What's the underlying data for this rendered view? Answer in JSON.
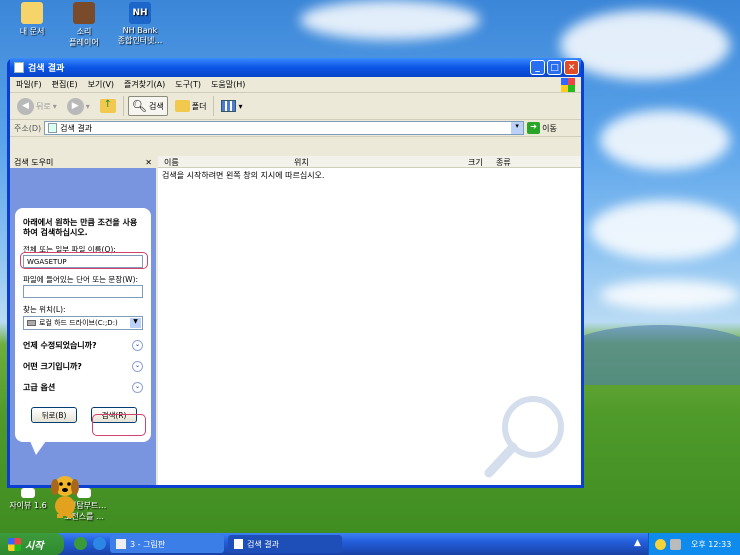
{
  "desktop": {
    "icons": [
      {
        "label": "내 문서",
        "icon": "folder-icon"
      },
      {
        "label": "소리\n플레이어",
        "icon": "speaker-icon"
      },
      {
        "label": "NH Bank\n종합인터넷…",
        "icon": "nh-bank-icon"
      },
      {
        "label": "자이뷰 1.6",
        "icon": "viewer-icon"
      },
      {
        "label": "강원탐부트…\n오전스를 …",
        "icon": "shortcut-icon"
      }
    ],
    "nh_badge": "NH"
  },
  "window": {
    "title": "검색 결과",
    "controls": {
      "minimize": "_",
      "maximize": "□",
      "close": "✕"
    },
    "menu": [
      "파일(F)",
      "편집(E)",
      "보기(V)",
      "즐겨찾기(A)",
      "도구(T)",
      "도움말(H)"
    ],
    "toolbar": {
      "back": "뒤로",
      "search": "검색",
      "folders": "폴더",
      "views_arrow": "▾",
      "forward_arrow": "▾"
    },
    "address": {
      "label": "주소(D)",
      "value": "검색 결과",
      "go": "이동"
    },
    "search_pane": {
      "header": "검색 도우미",
      "close": "✕",
      "intro": "아래에서 원하는 만큼 조건을 사용하여 검색하십시오.",
      "filename_label": "전체 또는 일부 파일 이름(O):",
      "filename_value": "WGASETUP",
      "content_label": "파일에 들어있는 단어 또는 문장(W):",
      "content_value": "",
      "location_label": "찾는 위치(L):",
      "location_value": "로컬 하드 드라이브(C:;D:)",
      "options": [
        "언제 수정되었습니까?",
        "어떤 크기입니까?",
        "고급 옵션"
      ],
      "back_button": "뒤로(B)",
      "search_button": "검색(R)"
    },
    "results": {
      "columns": [
        "이름",
        "위치",
        "크기",
        "종류"
      ],
      "message": "검색을 시작하려면 왼쪽 창의 지시에 따르십시오."
    }
  },
  "taskbar": {
    "start_label": "시작",
    "tasks": [
      "3 - 그림판",
      "검색 결과"
    ],
    "clock": "오후 12:33"
  },
  "colors": {
    "titlebar": "#0b55e5",
    "pane": "#7a95e0",
    "taskbar": "#245edb",
    "start": "#2f8a2f",
    "highlight": "#d1436a"
  }
}
